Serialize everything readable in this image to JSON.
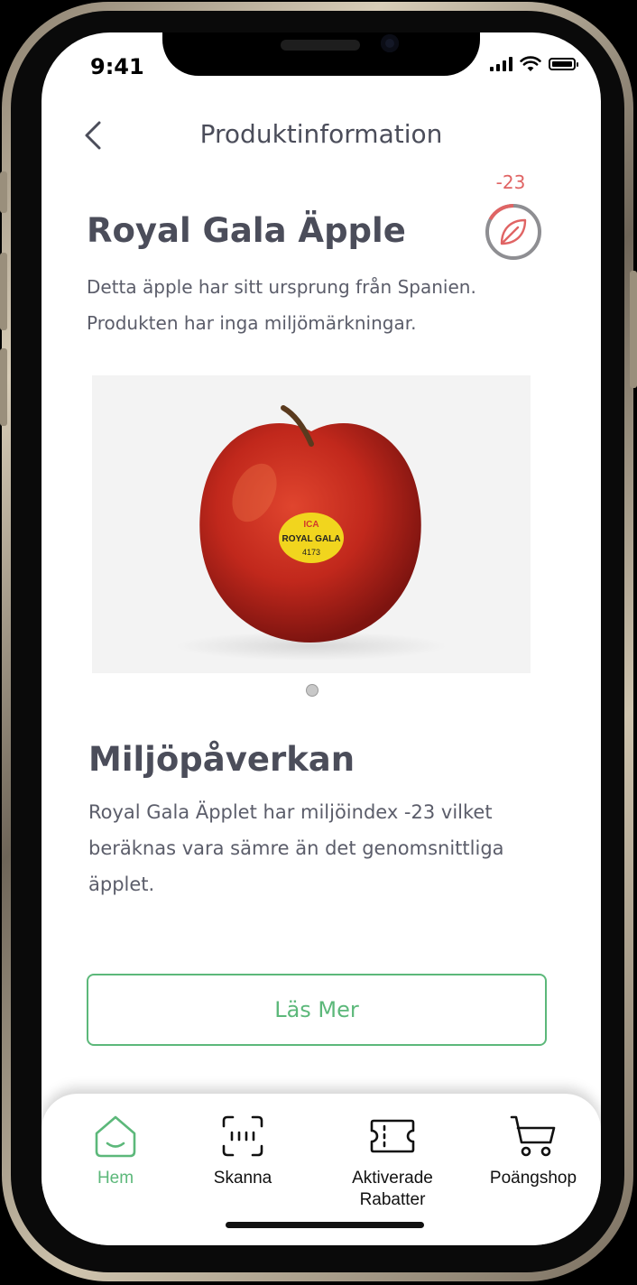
{
  "status_bar": {
    "time": "9:41"
  },
  "header": {
    "title": "Produktinformation",
    "back_icon": "chevron-left-icon"
  },
  "product": {
    "name": "Royal Gala Äpple",
    "description": "Detta äpple har sitt ursprung från Spanien. Produkten har inga miljömärkningar.",
    "eco_score": "-23",
    "eco_icon": "leaf-icon",
    "image_sticker": {
      "brand": "ICA",
      "name": "ROYAL GALA",
      "code": "4173"
    }
  },
  "environment": {
    "title": "Miljöpåverkan",
    "body": "Royal Gala Äpplet har miljöindex -23 vilket beräknas vara sämre än det genomsnittliga äpplet."
  },
  "read_more_label": "Läs Mer",
  "tab_bar": {
    "home": "Hem",
    "scan": "Skanna",
    "rebates_line1": "Aktiverade",
    "rebates_line2": "Rabatter",
    "shop": "Poängshop"
  },
  "colors": {
    "accent": "#5cb87a",
    "score": "#e06464",
    "text": "#4b4d5a"
  }
}
